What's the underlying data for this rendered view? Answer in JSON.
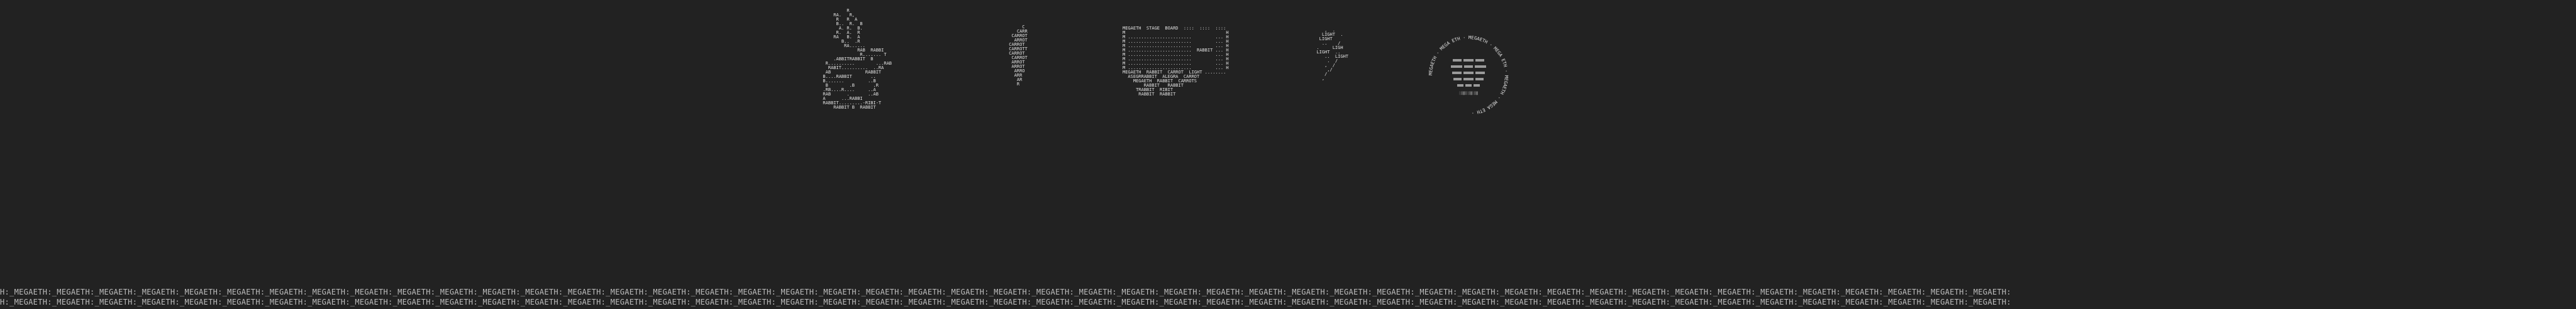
{
  "ascii_art": {
    "rabbit": "           R\n      RA.   R,\n       R   R  A\n       B..  R.  B\n        A. R.  B.\n       R.  A.  R\n      RA   B.  A\n         B..  .R\n          RA......\n               RAB  RABBI\n                R....... T\n      .ABBITRABBIT  B\n   R..........        ...RAB\n    RABIT..........  ..RA\n   AB             RABBIT\n  B....RABBIT       ..\n  B.......         ..B\n   B        .B       .R\n  .RB....R....     ..A\n  RAB      .       ..AB\n  A      ...RABBI\n  RABBIT.........-RIBI-T\n      RABBIT B  RABBIT",
    "carrot": "      C\n    CARR\n  CARROT\n   ARROT\n CARROT\n CARROTT\n CARROT\n  CARROT\n  ARROT\n  ARROT\n   ARRO\n   ARR\n    AR\n    R",
    "board": "MEGAETH  STAGE  BOARD  ::::  ::::  ::::\nM                                      H\nM ........................         ... H\nM ........................         ... H\nM ........................         ... H\nM ........................  RABBIT ... H\nM ........................         ... H\nM ........................         ... H\nM ........................         ... H\nM ........................         ... H\nMEGAETH  RABBIT  CARROT  LIGHT ........\n  ASEGRRABBIT  ALEGRA  CARROT\n    MEGAETH  RABBIT  CARROTS\n        RABBIT   RABBIT\n     TRABBIT  RIBIT\n      RABBIT  RABBIT",
    "bolt": "     ,  .\n    LIGHT  .\n   LIGHT\n    ..    /\n  .     LIGH\n  LIGHT  ..\n     ..  LIGHT\n      .  /\n     ,  /\n      ,/\n     /\n    ,"
  },
  "seal": {
    "ring_text": "MEGAETH · MEGA ETH · MEGAETH · MEGA ETH · MEGAETH · MEGA ETH · ",
    "center_text": "░▒▓▒░▒▓░▒▓"
  },
  "ticker": {
    "line1": "H:_MEGAETH:_MEGAETH:_MEGAETH:_MEGAETH:_MEGAETH:_MEGAETH:_MEGAETH:_MEGAETH:_MEGAETH:_MEGAETH:_MEGAETH:_MEGAETH:_MEGAETH:_MEGAETH:_MEGAETH:_MEGAETH:_MEGAETH:_MEGAETH:_MEGAETH:_MEGAETH:_MEGAETH:_MEGAETH:_MEGAETH:_MEGAETH:_MEGAETH:_MEGAETH:_MEGAETH:_MEGAETH:_MEGAETH:_MEGAETH:_MEGAETH:_MEGAETH:_MEGAETH:_MEGAETH:_MEGAETH:_MEGAETH:_MEGAETH:_MEGAETH:_MEGAETH:_MEGAETH:_MEGAETH:_MEGAETH:_MEGAETH:_MEGAETH:_MEGAETH:_MEGAETH:_MEGAETH:",
    "line2": "H:_MEGAETH:_MEGAETH:_MEGAETH:_MEGAETH:_MEGAETH:_MEGAETH:_MEGAETH:_MEGAETH:_MEGAETH:_MEGAETH:_MEGAETH:_MEGAETH:_MEGAETH:_MEGAETH:_MEGAETH:_MEGAETH:_MEGAETH:_MEGAETH:_MEGAETH:_MEGAETH:_MEGAETH:_MEGAETH:_MEGAETH:_MEGAETH:_MEGAETH:_MEGAETH:_MEGAETH:_MEGAETH:_MEGAETH:_MEGAETH:_MEGAETH:_MEGAETH:_MEGAETH:_MEGAETH:_MEGAETH:_MEGAETH:_MEGAETH:_MEGAETH:_MEGAETH:_MEGAETH:_MEGAETH:_MEGAETH:_MEGAETH:_MEGAETH:_MEGAETH:_MEGAETH:_MEGAETH:"
  }
}
